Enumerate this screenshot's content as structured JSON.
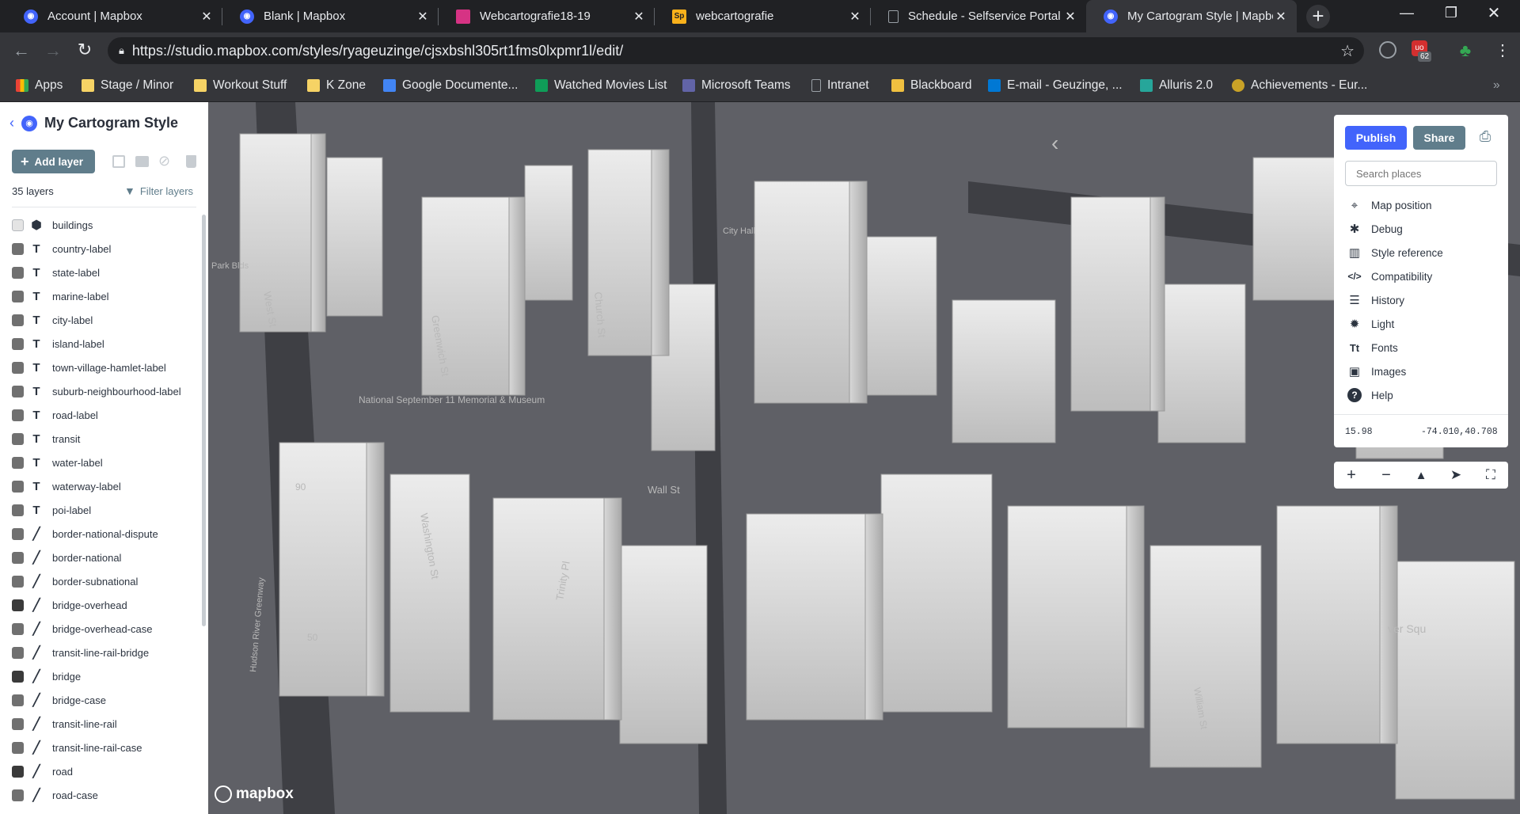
{
  "browser": {
    "tabs": [
      {
        "title": "Account | Mapbox",
        "favicon": "mapbox-icon",
        "color": "#4264fb"
      },
      {
        "title": "Blank | Mapbox",
        "favicon": "mapbox-icon",
        "color": "#4264fb"
      },
      {
        "title": "Webcartografie18-19",
        "favicon": "webcartografie-icon",
        "color": "#d63384"
      },
      {
        "title": "webcartografie",
        "favicon": "sp-icon",
        "color": "#f9b11b"
      },
      {
        "title": "Schedule - Selfservice Portal",
        "favicon": "page-icon",
        "color": "#9aa0a6"
      },
      {
        "title": "My Cartogram Style | Mapbox",
        "favicon": "mapbox-icon",
        "color": "#4264fb",
        "active": true
      }
    ],
    "url": "https://studio.mapbox.com/styles/ryageuzinge/cjsxbshl305rt1fms0lxpmr1l/edit/",
    "extension_badge": "62",
    "bookmarks": [
      {
        "label": "Apps",
        "icon": "apps-grid-icon",
        "color": "#ea4335"
      },
      {
        "label": "Stage / Minor",
        "icon": "folder-icon",
        "color": "#f6d365"
      },
      {
        "label": "Workout Stuff",
        "icon": "folder-icon",
        "color": "#f6d365"
      },
      {
        "label": "K Zone",
        "icon": "folder-icon",
        "color": "#f6d365"
      },
      {
        "label": "Google Documente...",
        "icon": "google-docs-icon",
        "color": "#4285f4"
      },
      {
        "label": "Watched Movies List",
        "icon": "google-sheets-icon",
        "color": "#0f9d58"
      },
      {
        "label": "Microsoft Teams",
        "icon": "teams-icon",
        "color": "#6264a7"
      },
      {
        "label": "Intranet",
        "icon": "page-icon",
        "color": "#9aa0a6"
      },
      {
        "label": "Blackboard",
        "icon": "blackboard-icon",
        "color": "#f0c040"
      },
      {
        "label": "E-mail - Geuzinge, ...",
        "icon": "outlook-icon",
        "color": "#0078d4"
      },
      {
        "label": "Alluris 2.0",
        "icon": "alluris-icon",
        "color": "#26a69a"
      },
      {
        "label": "Achievements - Eur...",
        "icon": "achievements-icon",
        "color": "#c9a227"
      }
    ]
  },
  "sidebar": {
    "title": "My Cartogram Style",
    "add_layer_label": "Add layer",
    "layer_count": "35 layers",
    "filter_label": "Filter layers",
    "layers": [
      {
        "name": "buildings",
        "type": "fill-extrusion-icon",
        "swatch": "#e4e4e4"
      },
      {
        "name": "country-label",
        "type": "symbol-icon",
        "swatch": "#707070"
      },
      {
        "name": "state-label",
        "type": "symbol-icon",
        "swatch": "#707070"
      },
      {
        "name": "marine-label",
        "type": "symbol-icon",
        "swatch": "#707070"
      },
      {
        "name": "city-label",
        "type": "symbol-icon",
        "swatch": "#707070"
      },
      {
        "name": "island-label",
        "type": "symbol-icon",
        "swatch": "#707070"
      },
      {
        "name": "town-village-hamlet-label",
        "type": "symbol-icon",
        "swatch": "#707070"
      },
      {
        "name": "suburb-neighbourhood-label",
        "type": "symbol-icon",
        "swatch": "#707070"
      },
      {
        "name": "road-label",
        "type": "symbol-icon",
        "swatch": "#707070"
      },
      {
        "name": "transit",
        "type": "symbol-icon",
        "swatch": "#707070"
      },
      {
        "name": "water-label",
        "type": "symbol-icon",
        "swatch": "#707070"
      },
      {
        "name": "waterway-label",
        "type": "symbol-icon",
        "swatch": "#707070"
      },
      {
        "name": "poi-label",
        "type": "symbol-icon",
        "swatch": "#707070"
      },
      {
        "name": "border-national-dispute",
        "type": "line-icon",
        "swatch": "#707070"
      },
      {
        "name": "border-national",
        "type": "line-icon",
        "swatch": "#707070"
      },
      {
        "name": "border-subnational",
        "type": "line-icon",
        "swatch": "#707070"
      },
      {
        "name": "bridge-overhead",
        "type": "line-icon",
        "swatch": "#3a3a3a"
      },
      {
        "name": "bridge-overhead-case",
        "type": "line-icon",
        "swatch": "#707070"
      },
      {
        "name": "transit-line-rail-bridge",
        "type": "line-icon",
        "swatch": "#707070"
      },
      {
        "name": "bridge",
        "type": "line-icon",
        "swatch": "#3a3a3a"
      },
      {
        "name": "bridge-case",
        "type": "line-icon",
        "swatch": "#707070"
      },
      {
        "name": "transit-line-rail",
        "type": "line-icon",
        "swatch": "#707070"
      },
      {
        "name": "transit-line-rail-case",
        "type": "line-icon",
        "swatch": "#707070"
      },
      {
        "name": "road",
        "type": "line-icon",
        "swatch": "#3a3a3a"
      },
      {
        "name": "road-case",
        "type": "line-icon",
        "swatch": "#707070"
      }
    ]
  },
  "map": {
    "labels": [
      "West St",
      "Greenwich St",
      "Church St",
      "National September 11 Memorial & Museum",
      "Washington St",
      "Trinity Pl",
      "Wall St",
      "Hudson River Greenway",
      "City Hall",
      "West St",
      "90",
      "50",
      "ver Squ",
      "William St",
      "Park Blds"
    ],
    "logo": "mapbox"
  },
  "panel": {
    "publish_label": "Publish",
    "share_label": "Share",
    "search_placeholder": "Search places",
    "items": [
      {
        "label": "Map position",
        "icon": "crosshair-icon"
      },
      {
        "label": "Debug",
        "icon": "bug-icon"
      },
      {
        "label": "Style reference",
        "icon": "book-icon"
      },
      {
        "label": "Compatibility",
        "icon": "code-icon"
      },
      {
        "label": "History",
        "icon": "history-icon"
      },
      {
        "label": "Light",
        "icon": "sun-icon"
      },
      {
        "label": "Fonts",
        "icon": "fonts-icon"
      },
      {
        "label": "Images",
        "icon": "image-icon"
      },
      {
        "label": "Help",
        "icon": "help-icon"
      }
    ],
    "zoom": "15.98",
    "coordinates": "-74.010,40.708"
  },
  "colors": {
    "accent": "#4264fb",
    "share": "#607d8b",
    "sidebar_bg": "#ffffff",
    "map_bg": "#5f6066",
    "building": "#dcdcdc"
  }
}
